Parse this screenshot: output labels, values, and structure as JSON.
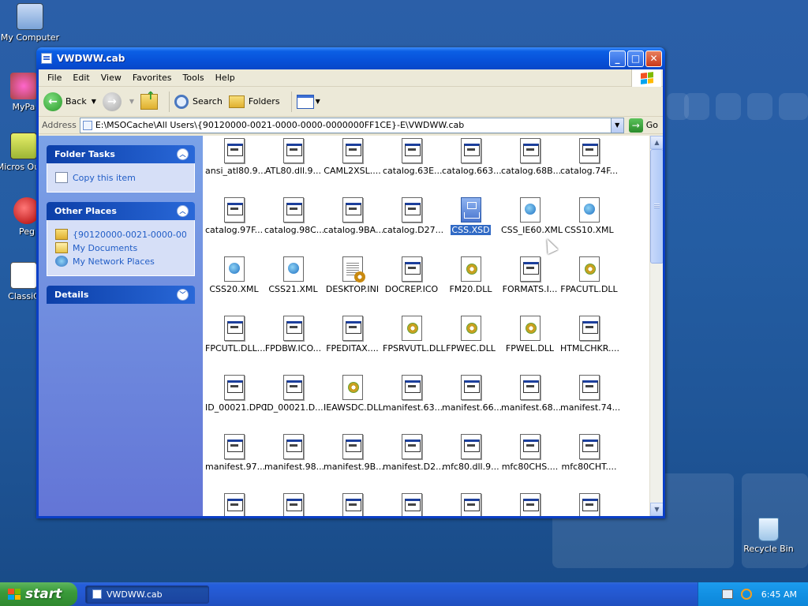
{
  "desktop": {
    "icons": [
      {
        "label": "My Computer"
      },
      {
        "label": "MyPa"
      },
      {
        "label": "Micros Outlo"
      },
      {
        "label": "Peg"
      },
      {
        "label": "ClassiC"
      },
      {
        "label": "Recycle Bin"
      }
    ]
  },
  "window": {
    "title": "VWDWW.cab",
    "controls": {
      "minimize": "_",
      "maximize": "□",
      "close": "✕"
    }
  },
  "menubar": [
    "File",
    "Edit",
    "View",
    "Favorites",
    "Tools",
    "Help"
  ],
  "toolbar": {
    "back": "Back",
    "search": "Search",
    "folders": "Folders"
  },
  "address": {
    "label": "Address",
    "value": "E:\\MSOCache\\All Users\\{90120000-0021-0000-0000-0000000FF1CE}-E\\VWDWW.cab",
    "go": "Go"
  },
  "taskpane": {
    "folder_tasks": {
      "title": "Folder Tasks",
      "items": [
        "Copy this item"
      ]
    },
    "other_places": {
      "title": "Other Places",
      "items": [
        "{90120000-0021-0000-000",
        "My Documents",
        "My Network Places"
      ]
    },
    "details": {
      "title": "Details"
    }
  },
  "files": [
    {
      "name": "ansi_atl80.9...",
      "icon": "doc"
    },
    {
      "name": "ATL80.dll.9...",
      "icon": "doc"
    },
    {
      "name": "CAML2XSL....",
      "icon": "doc"
    },
    {
      "name": "catalog.63E...",
      "icon": "doc"
    },
    {
      "name": "catalog.663...",
      "icon": "doc"
    },
    {
      "name": "catalog.68B...",
      "icon": "doc"
    },
    {
      "name": "catalog.74F...",
      "icon": "doc"
    },
    {
      "name": "catalog.97F...",
      "icon": "doc"
    },
    {
      "name": "catalog.98C...",
      "icon": "doc"
    },
    {
      "name": "catalog.9BA...",
      "icon": "doc"
    },
    {
      "name": "catalog.D27...",
      "icon": "doc"
    },
    {
      "name": "CSS.XSD",
      "icon": "xsd",
      "selected": true
    },
    {
      "name": "CSS_IE60.XML",
      "icon": "webdoc"
    },
    {
      "name": "CSS10.XML",
      "icon": "webdoc"
    },
    {
      "name": "CSS20.XML",
      "icon": "webdoc"
    },
    {
      "name": "CSS21.XML",
      "icon": "webdoc"
    },
    {
      "name": "DESKTOP.INI",
      "icon": "ini"
    },
    {
      "name": "DOCREP.ICO",
      "icon": "doc"
    },
    {
      "name": "FM20.DLL",
      "icon": "gear"
    },
    {
      "name": "FORMATS.I...",
      "icon": "doc"
    },
    {
      "name": "FPACUTL.DLL",
      "icon": "gear"
    },
    {
      "name": "FPCUTL.DLL...",
      "icon": "doc"
    },
    {
      "name": "FPDBW.ICO...",
      "icon": "doc"
    },
    {
      "name": "FPEDITAX....",
      "icon": "doc"
    },
    {
      "name": "FPSRVUTL.DLL",
      "icon": "gear"
    },
    {
      "name": "FPWEC.DLL",
      "icon": "gear"
    },
    {
      "name": "FPWEL.DLL",
      "icon": "gear"
    },
    {
      "name": "HTMLCHKR....",
      "icon": "doc"
    },
    {
      "name": "ID_00021.DPC",
      "icon": "doc"
    },
    {
      "name": "ID_00021.D...",
      "icon": "doc"
    },
    {
      "name": "IEAWSDC.DLL",
      "icon": "gear"
    },
    {
      "name": "manifest.63...",
      "icon": "doc"
    },
    {
      "name": "manifest.66...",
      "icon": "doc"
    },
    {
      "name": "manifest.68...",
      "icon": "doc"
    },
    {
      "name": "manifest.74...",
      "icon": "doc"
    },
    {
      "name": "manifest.97...",
      "icon": "doc"
    },
    {
      "name": "manifest.98...",
      "icon": "doc"
    },
    {
      "name": "manifest.9B...",
      "icon": "doc"
    },
    {
      "name": "manifest.D2...",
      "icon": "doc"
    },
    {
      "name": "mfc80.dll.9...",
      "icon": "doc"
    },
    {
      "name": "mfc80CHS....",
      "icon": "doc"
    },
    {
      "name": "mfc80CHT....",
      "icon": "doc"
    },
    {
      "name": "",
      "icon": "doc"
    },
    {
      "name": "",
      "icon": "doc"
    },
    {
      "name": "",
      "icon": "doc"
    },
    {
      "name": "",
      "icon": "doc"
    },
    {
      "name": "",
      "icon": "doc"
    },
    {
      "name": "",
      "icon": "doc"
    },
    {
      "name": "",
      "icon": "doc"
    }
  ],
  "taskbar": {
    "start": "start",
    "task": "VWDWW.cab",
    "clock": "6:45 AM"
  }
}
